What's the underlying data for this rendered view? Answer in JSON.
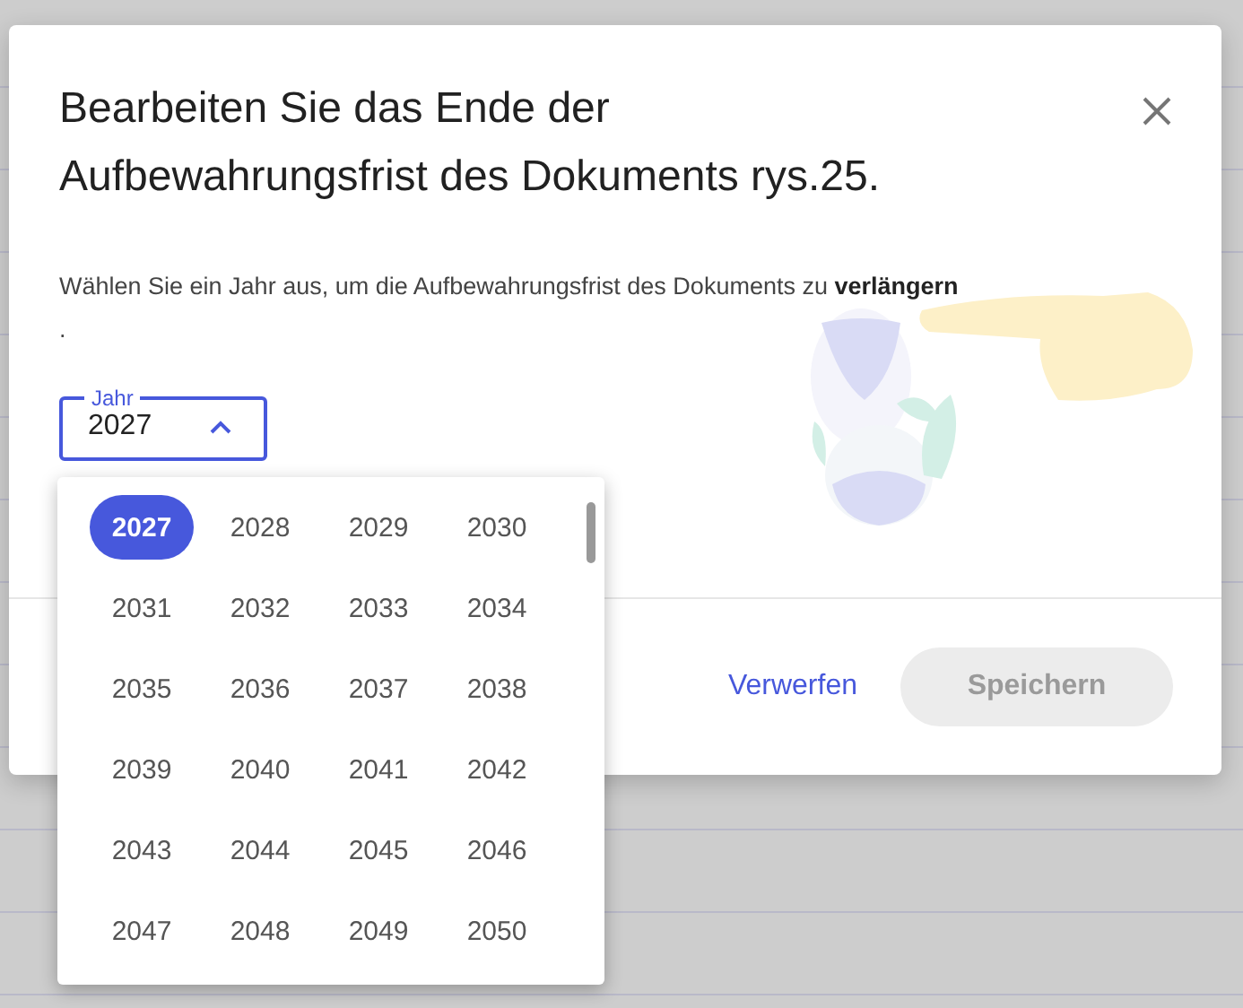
{
  "dialog": {
    "title": "Bearbeiten Sie das Ende der Aufbewahrungsfrist des Dokuments rys.25.",
    "description": "Wählen Sie ein Jahr aus, um die Aufbewahrungsfrist des Dokuments zu **verlängern**\n.",
    "year_field": {
      "label": "Jahr",
      "value": "2027",
      "expanded": true
    },
    "years": [
      {
        "label": "2027",
        "selected": true
      },
      {
        "label": "2028",
        "selected": false
      },
      {
        "label": "2029",
        "selected": false
      },
      {
        "label": "2030",
        "selected": false
      },
      {
        "label": "2031",
        "selected": false
      },
      {
        "label": "2032",
        "selected": false
      },
      {
        "label": "2033",
        "selected": false
      },
      {
        "label": "2034",
        "selected": false
      },
      {
        "label": "2035",
        "selected": false
      },
      {
        "label": "2036",
        "selected": false
      },
      {
        "label": "2037",
        "selected": false
      },
      {
        "label": "2038",
        "selected": false
      },
      {
        "label": "2039",
        "selected": false
      },
      {
        "label": "2040",
        "selected": false
      },
      {
        "label": "2041",
        "selected": false
      },
      {
        "label": "2042",
        "selected": false
      },
      {
        "label": "2043",
        "selected": false
      },
      {
        "label": "2044",
        "selected": false
      },
      {
        "label": "2045",
        "selected": false
      },
      {
        "label": "2046",
        "selected": false
      },
      {
        "label": "2047",
        "selected": false
      },
      {
        "label": "2048",
        "selected": false
      },
      {
        "label": "2049",
        "selected": false
      },
      {
        "label": "2050",
        "selected": false
      }
    ],
    "buttons": [
      {
        "label": "Verwerfen",
        "kind": "text",
        "disabled": false
      },
      {
        "label": "Speichern",
        "kind": "filled",
        "disabled": true
      }
    ]
  }
}
